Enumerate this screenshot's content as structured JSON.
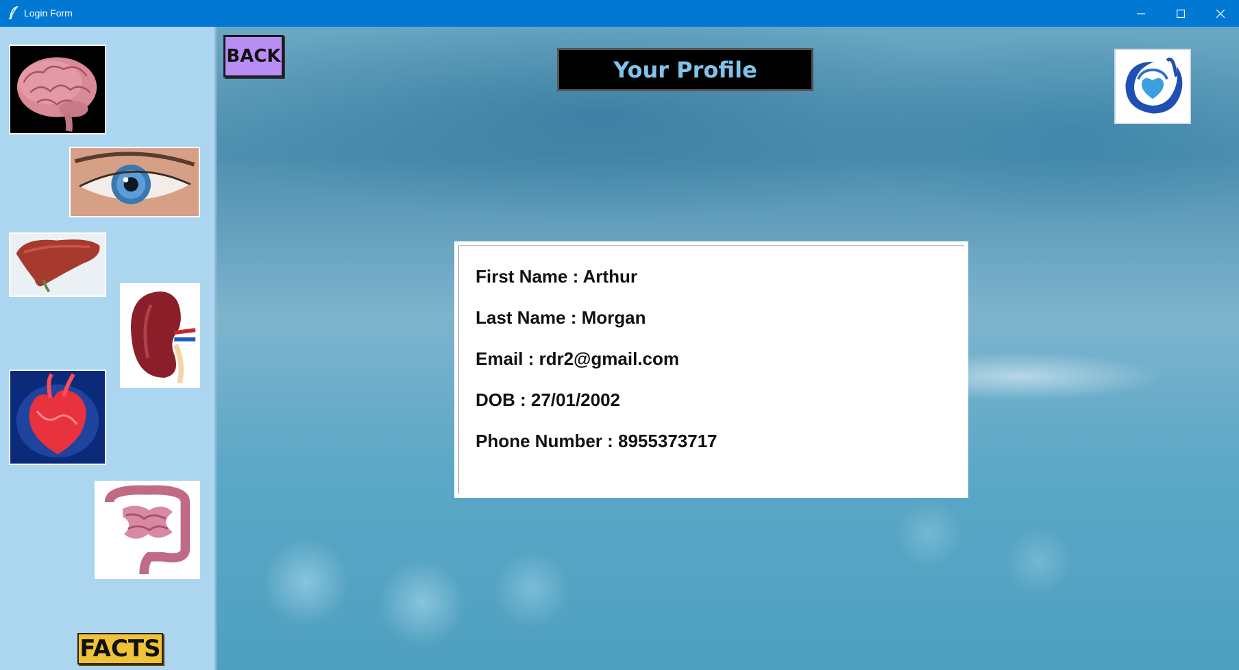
{
  "window": {
    "title": "Login Form",
    "controls": [
      "minimize-icon",
      "maximize-icon",
      "close-icon"
    ]
  },
  "sidebar": {
    "organs": [
      "brain",
      "eye",
      "liver",
      "kidney",
      "heart",
      "intestines"
    ],
    "facts_label": "FACTS"
  },
  "header": {
    "back_label": "BACK",
    "title": "Your Profile"
  },
  "profile": {
    "first_name": "First Name : Arthur",
    "last_name": "Last Name : Morgan",
    "email": "Email : rdr2@gmail.com",
    "dob": "DOB : 27/01/2002",
    "phone": "Phone Number : 8955373717"
  },
  "colors": {
    "titlebar": "#0078d4",
    "sidebar": "#acd6ef",
    "back_button": "#b88ef5",
    "facts_button": "#f0c23a",
    "title_text": "#7ec4ea",
    "logo_blue": "#1f4fb5"
  }
}
